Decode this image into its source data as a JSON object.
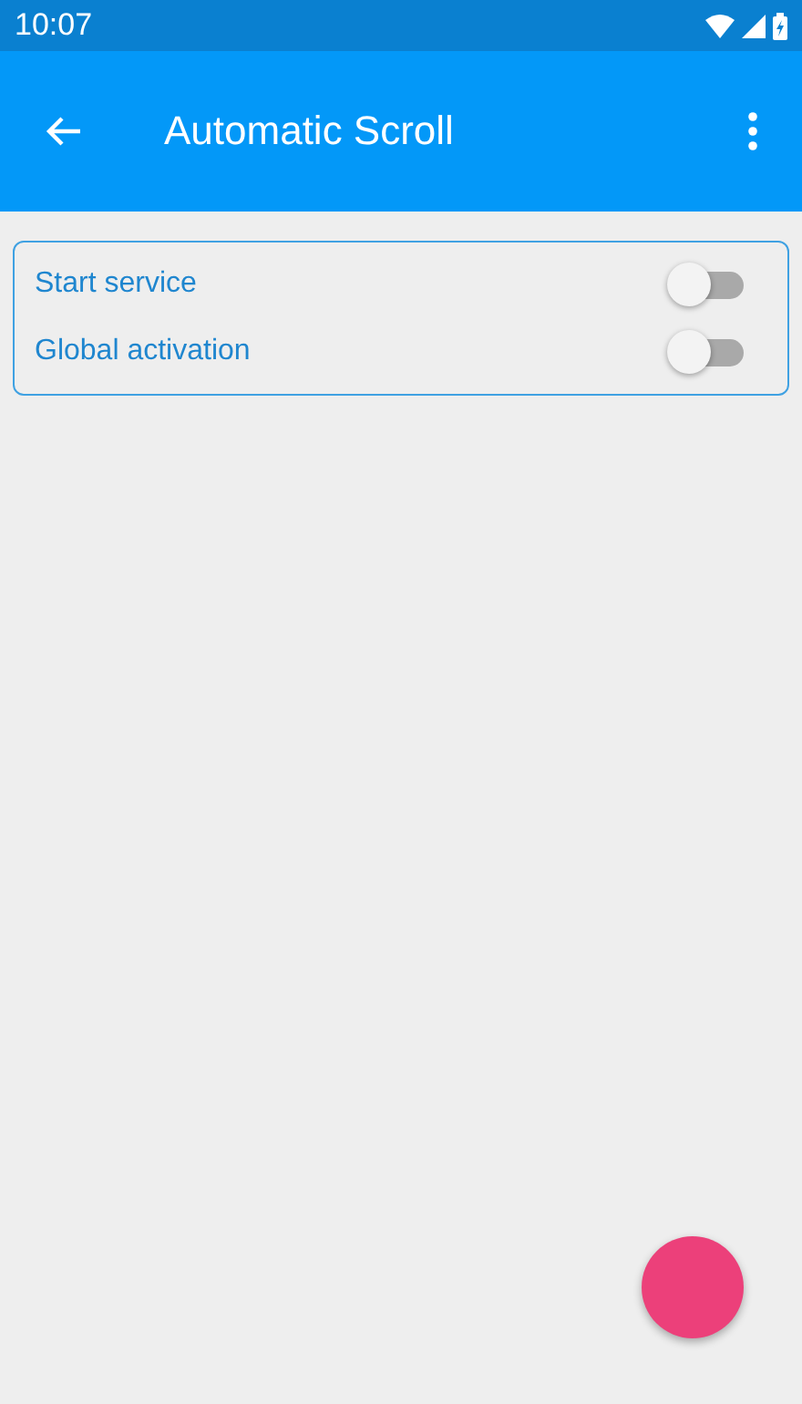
{
  "status_bar": {
    "time": "10:07"
  },
  "app_bar": {
    "title": "Automatic Scroll"
  },
  "settings": [
    {
      "label": "Start service",
      "on": false
    },
    {
      "label": "Global activation",
      "on": false
    }
  ]
}
